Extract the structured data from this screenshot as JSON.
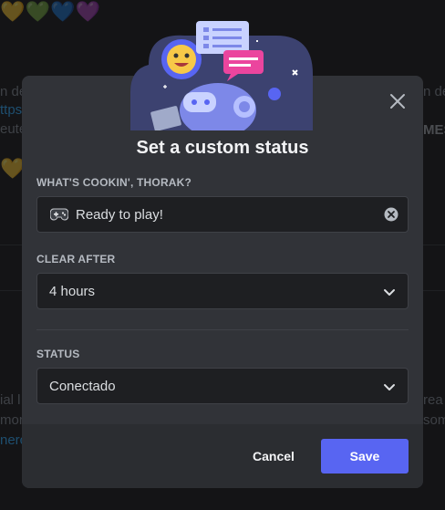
{
  "background": {
    "hearts_top": [
      "💛",
      "💚",
      "💙",
      "💜"
    ],
    "hearts_mid": [
      "💛",
      "💛"
    ],
    "snippets": [
      {
        "text": "n de"
      },
      {
        "text": "ttps:"
      },
      {
        "text": "eute"
      },
      {
        "text": "n de"
      },
      {
        "text": "MES"
      },
      {
        "text": "ial l"
      },
      {
        "text": "mor"
      },
      {
        "text": "nerc"
      },
      {
        "text": "rea"
      },
      {
        "text": "som"
      }
    ]
  },
  "modal": {
    "title": "Set a custom status",
    "status_section": {
      "label": "WHAT'S COOKIN', THORAK?",
      "emoji": "gamepad-icon",
      "value": "Ready to play!"
    },
    "clear_after": {
      "label": "CLEAR AFTER",
      "selected": "4 hours"
    },
    "status": {
      "label": "STATUS",
      "selected": "Conectado"
    },
    "footer": {
      "cancel_label": "Cancel",
      "save_label": "Save"
    }
  },
  "colors": {
    "accent": "#5865f2",
    "modal_bg": "#313338",
    "footer_bg": "#2b2d31",
    "input_bg": "#1e1f22"
  }
}
